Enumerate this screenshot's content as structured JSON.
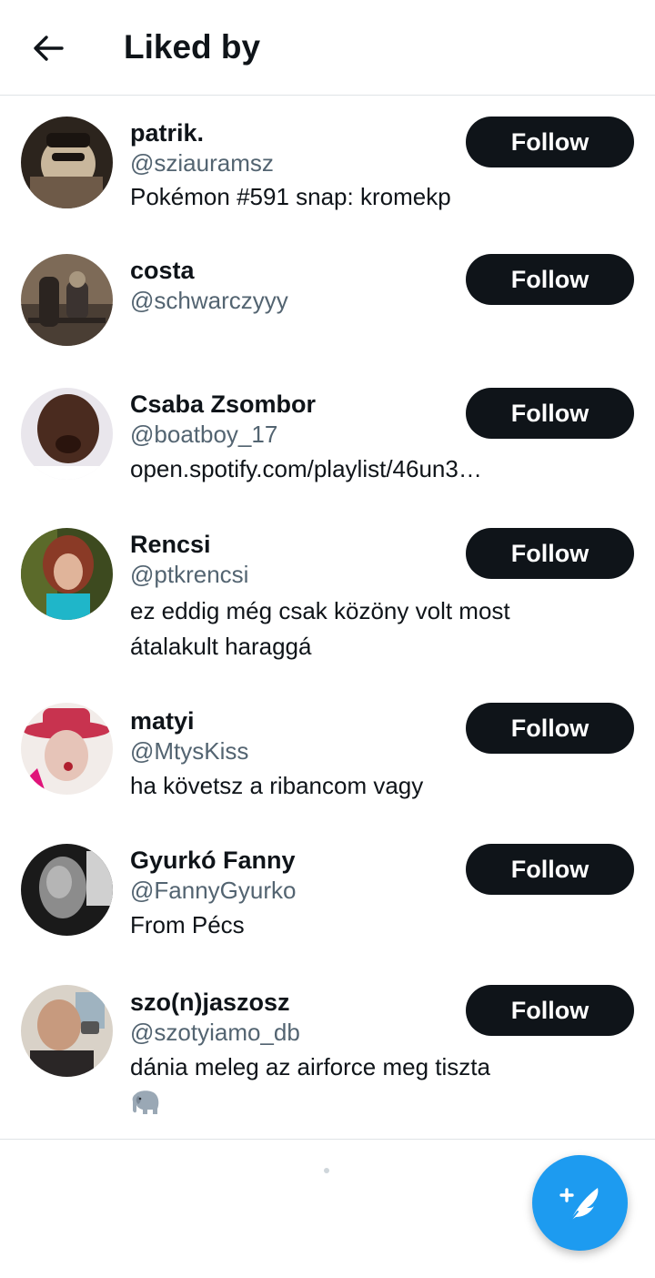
{
  "header": {
    "title": "Liked by",
    "back_icon": "arrow-left-icon"
  },
  "users": [
    {
      "name": "patrik.",
      "handle": "@sziauramsz",
      "bio_lines": [
        "Pokémon #591 snap: kromekp"
      ],
      "follow_label": "Follow",
      "avatar_colors": [
        "#3a3128",
        "#c9b79c",
        "#6e5a48"
      ]
    },
    {
      "name": "costa",
      "handle": "@schwarczyyy",
      "bio_lines": [],
      "follow_label": "Follow",
      "avatar_colors": [
        "#6b5a4a",
        "#2b2420",
        "#a8977f"
      ]
    },
    {
      "name": "Csaba Zsombor",
      "handle": "@boatboy_17",
      "bio_lines": [
        "open.spotify.com/playlist/46un3…"
      ],
      "follow_label": "Follow",
      "avatar_colors": [
        "#e9e6ec",
        "#4a2b1f",
        "#ffffff"
      ]
    },
    {
      "name": "Rencsi",
      "handle": "@ptkrencsi",
      "bio_lines": [
        "ez eddig még csak közöny volt most",
        "átalakult haraggá"
      ],
      "follow_label": "Follow",
      "avatar_colors": [
        "#3d4a1f",
        "#b2573f",
        "#1fb6c9"
      ]
    },
    {
      "name": "matyi",
      "handle": "@MtysKiss",
      "bio_lines": [
        "ha követsz a ribancom vagy"
      ],
      "follow_label": "Follow",
      "avatar_colors": [
        "#c8334f",
        "#e6c4b8",
        "#e0147a"
      ]
    },
    {
      "name": "Gyurkó Fanny",
      "handle": "@FannyGyurko",
      "bio_lines": [
        "From Pécs"
      ],
      "follow_label": "Follow",
      "avatar_colors": [
        "#1a1a1a",
        "#8c8c8c",
        "#d0d0d0"
      ]
    },
    {
      "name": "szo(n)jaszosz",
      "handle": "@szotyiamo_db",
      "bio_lines": [
        "dánia meleg az airforce meg tiszta"
      ],
      "bio_emoji": "elephant-emoji",
      "follow_label": "Follow",
      "avatar_colors": [
        "#d9d2c8",
        "#c79a7e",
        "#2a2626"
      ]
    }
  ],
  "fab": {
    "icon": "compose-tweet-icon",
    "color": "#1d9bf0"
  },
  "colors": {
    "text_primary": "#0f1419",
    "text_secondary": "#536471",
    "button_bg": "#0f1419",
    "divider": "#dfe3e6"
  }
}
